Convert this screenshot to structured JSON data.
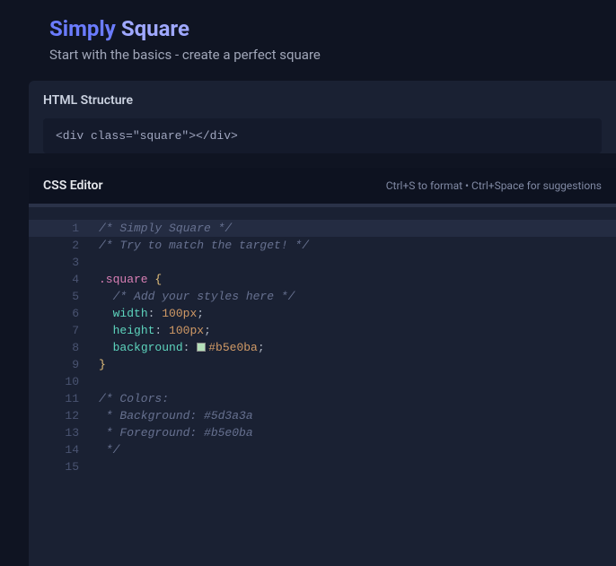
{
  "header": {
    "title_accent": "Simply",
    "title_rest": "Square",
    "subtitle": "Start with the basics - create a perfect square"
  },
  "html_panel": {
    "label": "HTML Structure",
    "code": "<div class=\"square\"></div>"
  },
  "css_editor": {
    "title": "CSS Editor",
    "hints": "Ctrl+S to format • Ctrl+Space for suggestions"
  },
  "code": {
    "lines": [
      {
        "n": "1",
        "tokens": [
          {
            "t": "/* Simply Square */",
            "c": "tok-comment"
          }
        ],
        "hl": true
      },
      {
        "n": "2",
        "tokens": [
          {
            "t": "/* Try to match the target! */",
            "c": "tok-comment"
          }
        ]
      },
      {
        "n": "3",
        "tokens": []
      },
      {
        "n": "4",
        "tokens": [
          {
            "t": ".square",
            "c": "tok-selector"
          },
          {
            "t": " ",
            "c": ""
          },
          {
            "t": "{",
            "c": "tok-brace"
          }
        ]
      },
      {
        "n": "5",
        "tokens": [
          {
            "t": "  ",
            "c": ""
          },
          {
            "t": "/* Add your styles here */",
            "c": "tok-comment"
          }
        ]
      },
      {
        "n": "6",
        "tokens": [
          {
            "t": "  ",
            "c": ""
          },
          {
            "t": "width",
            "c": "tok-property"
          },
          {
            "t": ":",
            "c": "tok-punct"
          },
          {
            "t": " ",
            "c": ""
          },
          {
            "t": "100px",
            "c": "tok-value"
          },
          {
            "t": ";",
            "c": "tok-punct"
          }
        ]
      },
      {
        "n": "7",
        "tokens": [
          {
            "t": "  ",
            "c": ""
          },
          {
            "t": "height",
            "c": "tok-property"
          },
          {
            "t": ":",
            "c": "tok-punct"
          },
          {
            "t": " ",
            "c": ""
          },
          {
            "t": "100px",
            "c": "tok-value"
          },
          {
            "t": ";",
            "c": "tok-punct"
          }
        ]
      },
      {
        "n": "8",
        "tokens": [
          {
            "t": "  ",
            "c": ""
          },
          {
            "t": "background",
            "c": "tok-property"
          },
          {
            "t": ":",
            "c": "tok-punct"
          },
          {
            "t": " ",
            "c": ""
          },
          {
            "t": "SWATCH",
            "c": "swatch"
          },
          {
            "t": "#b5e0ba",
            "c": "tok-value"
          },
          {
            "t": ";",
            "c": "tok-punct"
          }
        ]
      },
      {
        "n": "9",
        "tokens": [
          {
            "t": "}",
            "c": "tok-brace"
          }
        ]
      },
      {
        "n": "10",
        "tokens": []
      },
      {
        "n": "11",
        "tokens": [
          {
            "t": "/* Colors:",
            "c": "tok-comment"
          }
        ]
      },
      {
        "n": "12",
        "tokens": [
          {
            "t": " * Background: #5d3a3a",
            "c": "tok-comment"
          }
        ]
      },
      {
        "n": "13",
        "tokens": [
          {
            "t": " * Foreground: #b5e0ba",
            "c": "tok-comment"
          }
        ]
      },
      {
        "n": "14",
        "tokens": [
          {
            "t": " */",
            "c": "tok-comment"
          }
        ]
      },
      {
        "n": "15",
        "tokens": []
      }
    ]
  }
}
